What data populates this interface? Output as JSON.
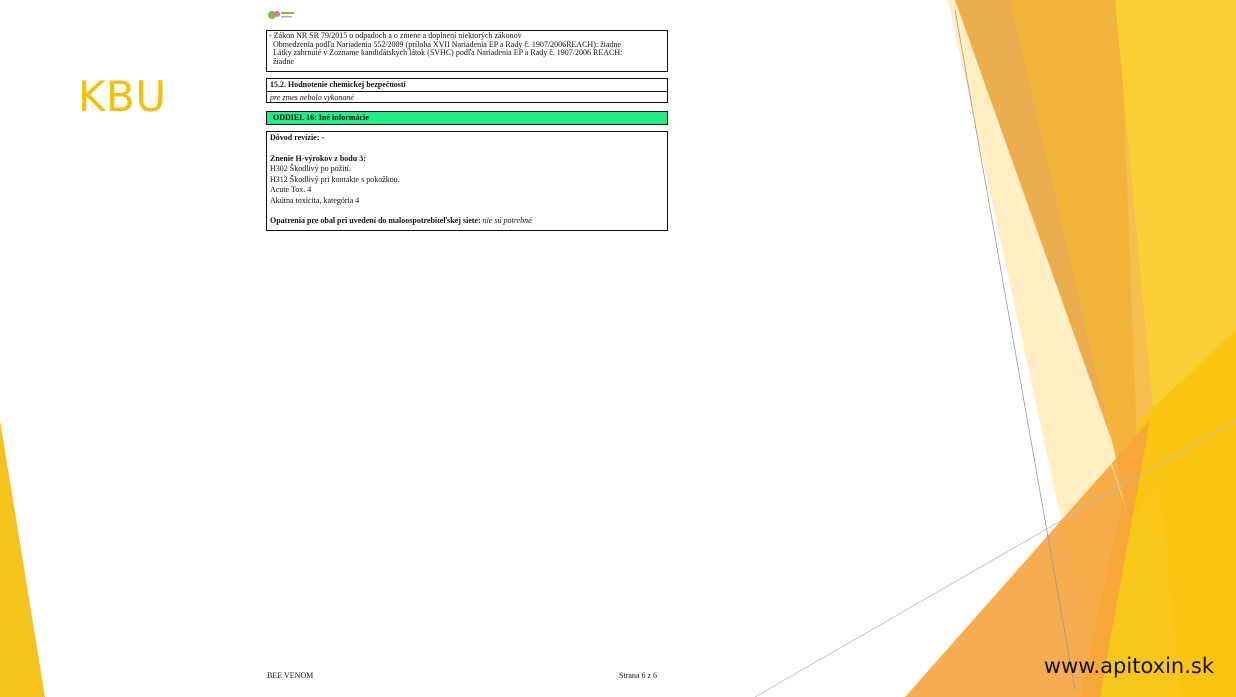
{
  "slide": {
    "title": "KBU",
    "website": "www.apitoxin.sk",
    "colors": {
      "title": "#f5c000",
      "accent_green": "#22ee88"
    }
  },
  "doc": {
    "logo_icon": "bee-venom-logo-icon",
    "box1": {
      "line1": "- Zákon NR SR 79/2015 o odpadoch a o zmene a doplnení niektorých zákonov",
      "line2": "Obmedzenia podľa Nariadenia 552/2009 (príloha XVII Nariadenia EP a Rady č. 1907/2006REACH): žiadne",
      "line3": "Látky zahrnuté v  Zozname kandidátskych látok (SVHC) podľa Nariadenia EP a Rady č. 1907/2006 REACH:",
      "line4": "žiadne"
    },
    "box2": {
      "heading": "15.2. Hodnotenie chemickej bezpečnosti",
      "text": "pre zmes nebolo vykonané"
    },
    "section16": "ODDIEL 16: Iné informácie",
    "box4": {
      "revision": "Dôvod revízie: -",
      "h_heading": "Znenie H-výrokov z bodu 3:",
      "h1": "H302 Škodlivý po požití.",
      "h2": "H312 Škodlivý pri kontakte s pokožkou.",
      "h3": "Acute Tox. 4",
      "h4": "Akútna toxicita, kategória 4",
      "packaging_label": "Opatrenia pre obal pri uvedení do maloospotrebiteľskej siete:",
      "packaging_value": "nie sú potrebné"
    },
    "footer": {
      "product": "BEE VENOM",
      "page": "Strana 6 z 6"
    }
  }
}
